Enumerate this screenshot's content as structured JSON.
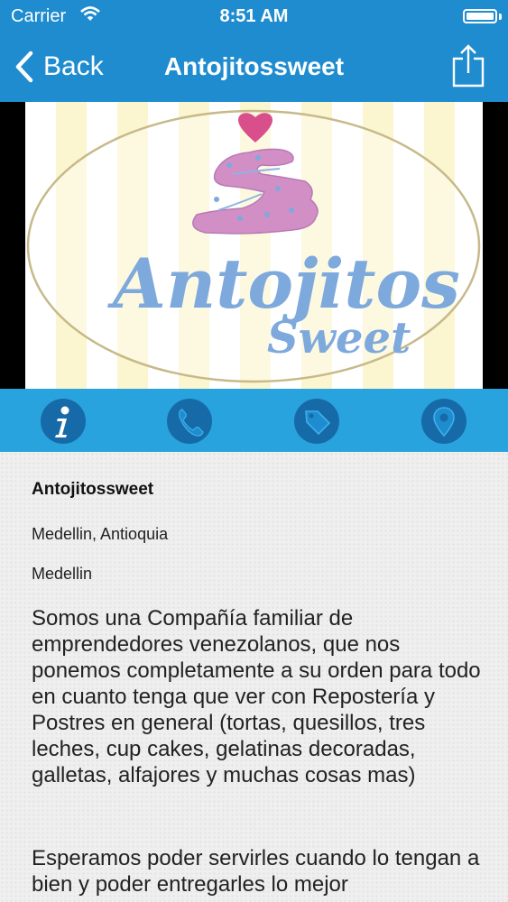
{
  "status_bar": {
    "carrier": "Carrier",
    "time": "8:51 AM",
    "icons": [
      "wifi-icon",
      "battery-icon"
    ]
  },
  "nav": {
    "back_label": "Back",
    "title": "Antojitossweet",
    "share_icon": "share-icon"
  },
  "banner": {
    "logo_line1": "Antojitos",
    "logo_line2": "Sweet",
    "colors": {
      "logo_text": "#7ea9dc",
      "cupcake": "#d28fc6",
      "heart": "#d94f8b",
      "oval_border": "#c7b98a"
    }
  },
  "action_bar": {
    "buttons": [
      {
        "name": "info",
        "icon": "info-icon"
      },
      {
        "name": "phone",
        "icon": "phone-icon"
      },
      {
        "name": "tag",
        "icon": "tag-icon"
      },
      {
        "name": "location",
        "icon": "location-pin-icon"
      }
    ]
  },
  "details": {
    "name": "Antojitossweet",
    "location": "Medellin, Antioquia",
    "city": "Medellin",
    "description": "Somos una Compañía familiar de emprendedores venezolanos, que nos ponemos completamente a su orden para todo en cuanto tenga que ver con Repostería y Postres en general (tortas, quesillos, tres leches, cup cakes, gelatinas decoradas, galletas, alfajores y muchas cosas mas)",
    "description2": "Esperamos poder servirles cuando lo tengan a bien y poder entregarles lo mejor"
  },
  "colors": {
    "nav_bg": "#1e8ccf",
    "action_bar_bg": "#28a3dd",
    "action_button_bg": "#176aa8"
  }
}
